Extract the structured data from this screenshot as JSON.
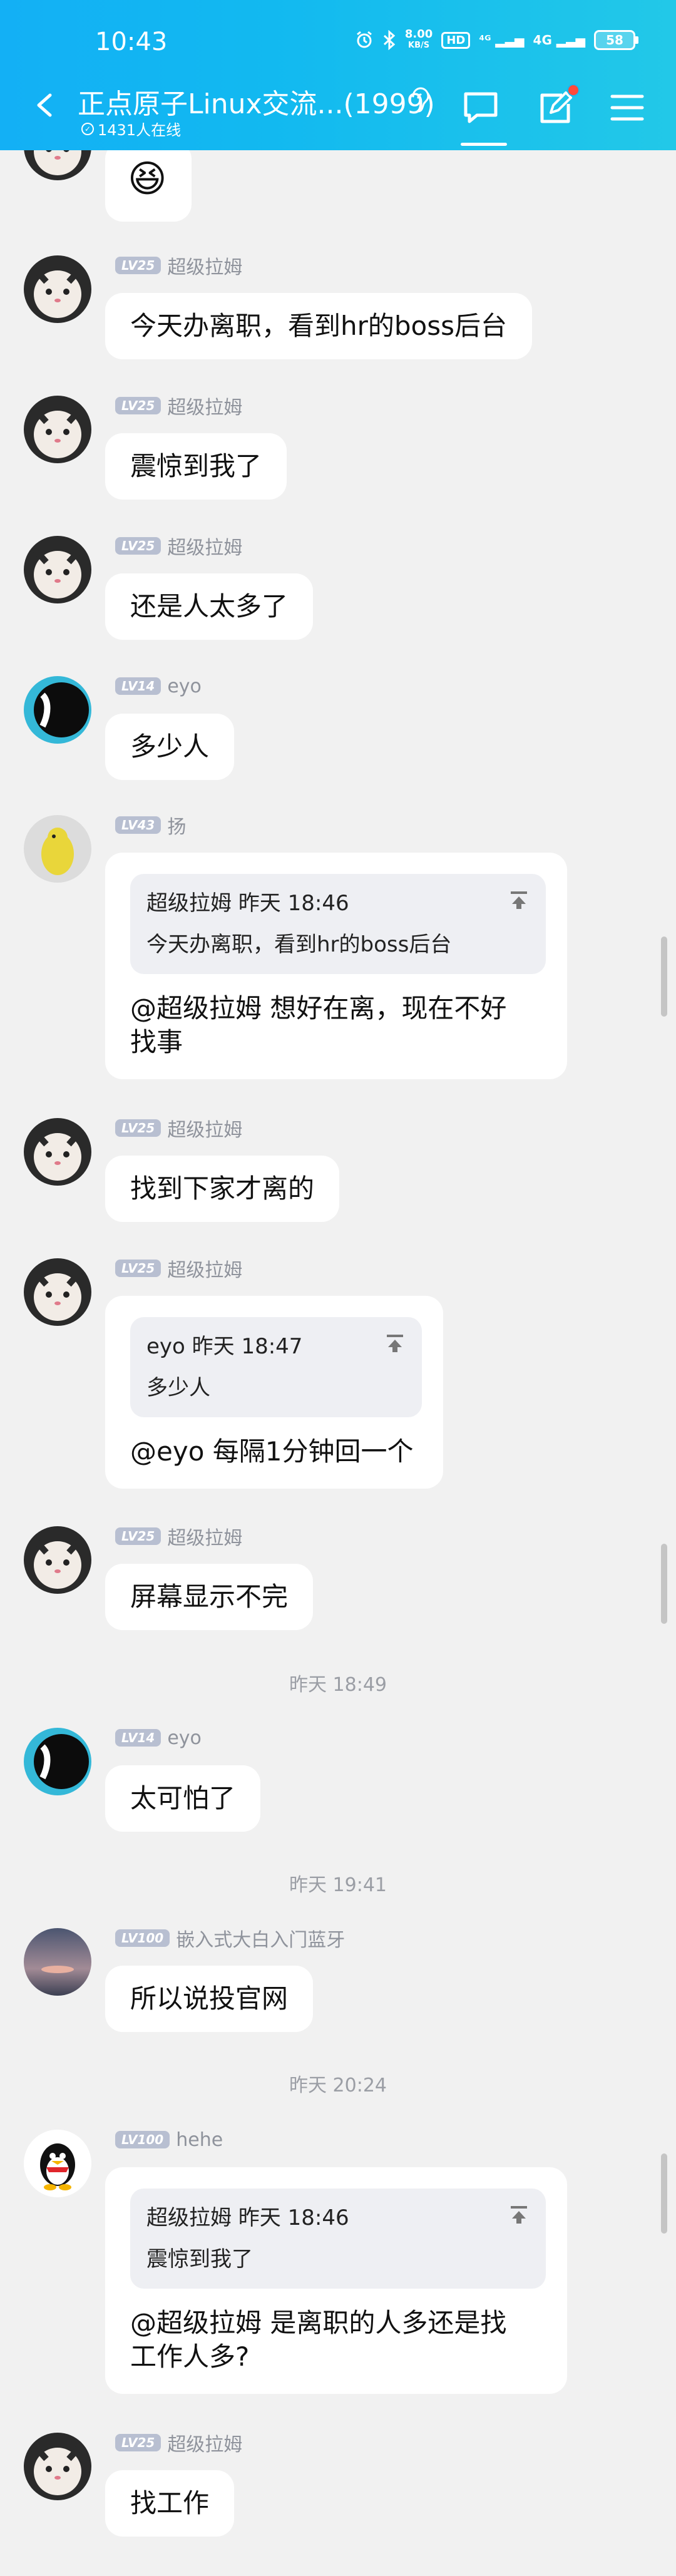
{
  "status_bar": {
    "time": "10:43",
    "net_speed_value": "8.00",
    "net_speed_unit": "KB/S",
    "hd": "HD",
    "sig1": "⁴ᴳ",
    "sig2": "4G",
    "battery": "58"
  },
  "header": {
    "title": "正点原子Linux交流...(1999)",
    "online": "1431人在线"
  },
  "messages": [
    {
      "kind": "emoji",
      "emoji": "😆"
    },
    {
      "kind": "msg",
      "level": "LV25",
      "name": "超级拉姆",
      "text": "今天办离职，看到hr的boss后台"
    },
    {
      "kind": "msg",
      "level": "LV25",
      "name": "超级拉姆",
      "text": "震惊到我了"
    },
    {
      "kind": "msg",
      "level": "LV25",
      "name": "超级拉姆",
      "text": "还是人太多了"
    },
    {
      "kind": "msg",
      "level": "LV14",
      "name": "eyo",
      "text": "多少人"
    },
    {
      "kind": "reply",
      "level": "LV43",
      "name": "扬",
      "quote_head": "超级拉姆 昨天 18:46",
      "quote_body": "今天办离职，看到hr的boss后台",
      "text": "@超级拉姆 想好在离，现在不好\n找事"
    },
    {
      "kind": "msg",
      "level": "LV25",
      "name": "超级拉姆",
      "text": "找到下家才离的"
    },
    {
      "kind": "reply",
      "level": "LV25",
      "name": "超级拉姆",
      "quote_head": "eyo 昨天 18:47",
      "quote_body": "多少人",
      "text": "@eyo 每隔1分钟回一个"
    },
    {
      "kind": "msg",
      "level": "LV25",
      "name": "超级拉姆",
      "text": "屏幕显示不完"
    },
    {
      "kind": "msg",
      "level": "LV14",
      "name": "eyo",
      "text": "太可怕了"
    },
    {
      "kind": "msg",
      "level": "LV100",
      "name": "嵌入式大白入门蓝牙",
      "text": "所以说投官网"
    },
    {
      "kind": "reply",
      "level": "LV100",
      "name": "hehe",
      "quote_head": "超级拉姆 昨天 18:46",
      "quote_body": "震惊到我了",
      "text": "@超级拉姆 是离职的人多还是找\n工作人多?"
    },
    {
      "kind": "msg",
      "level": "LV25",
      "name": "超级拉姆",
      "text": "找工作"
    }
  ],
  "timestamps": [
    "昨天 18:49",
    "昨天 19:41",
    "昨天 20:24"
  ]
}
